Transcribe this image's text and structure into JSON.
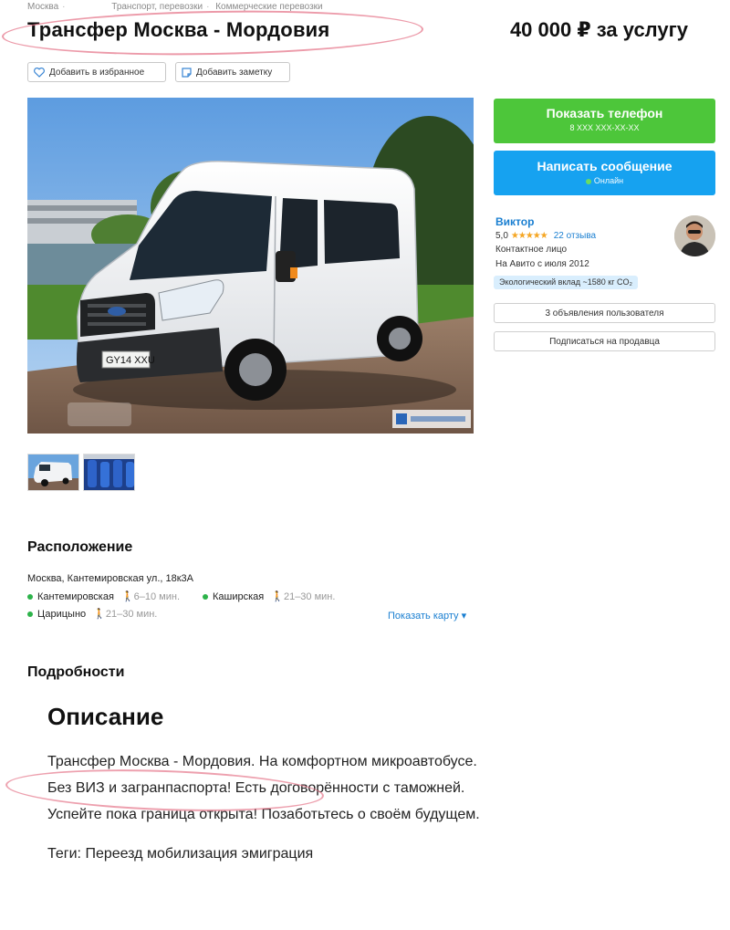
{
  "breadcrumbs": [
    "Москва",
    "Транспорт, перевозки",
    "Коммерческие перевозки"
  ],
  "title": "Трансфер Москва - Мордовия",
  "price": "40 000 ₽ за услугу",
  "actions": {
    "favorite": "Добавить в избранное",
    "note": "Добавить заметку"
  },
  "photo": {
    "plate": "GY14 XXU"
  },
  "contact": {
    "show_phone": "Показать телефон",
    "phone_mask": "8 XXX XXX-XX-XX",
    "write_message": "Написать сообщение",
    "online": "Онлайн"
  },
  "seller": {
    "name": "Виктор",
    "rating": "5,0",
    "stars": "★★★★★",
    "reviews": "22 отзыва",
    "role": "Контактное лицо",
    "since": "На Авито с июля 2012",
    "eco": "Экологический вклад ~1580 кг CO₂",
    "listings_button": "3 объявления пользователя",
    "subscribe_button": "Подписаться на продавца"
  },
  "location": {
    "heading": "Расположение",
    "address": "Москва, Кантемировская ул., 18к3А",
    "metro": [
      {
        "name": "Кантемировская",
        "time": "6–10 мин.",
        "color": "#2db34a"
      },
      {
        "name": "Каширская",
        "time": "21–30 мин.",
        "color": "#2db34a"
      },
      {
        "name": "Царицыно",
        "time": "21–30 мин.",
        "color": "#2db34a"
      }
    ],
    "show_map": "Показать карту"
  },
  "details": {
    "heading": "Подробности",
    "description_title": "Описание",
    "lines": [
      "Трансфер Москва - Мордовия. На комфортном микроавтобусе.",
      "Без ВИЗ и загранпаспорта! Есть договорённости с таможней.",
      "Успейте пока граница открыта! Позаботьтесь о своём будущем."
    ],
    "tags": "Теги: Переезд мобилизация эмиграция"
  },
  "colors": {
    "green": "#4dc63a",
    "blue": "#16a2f0",
    "link": "#1a7fd1",
    "annotation": "#e6788c"
  }
}
